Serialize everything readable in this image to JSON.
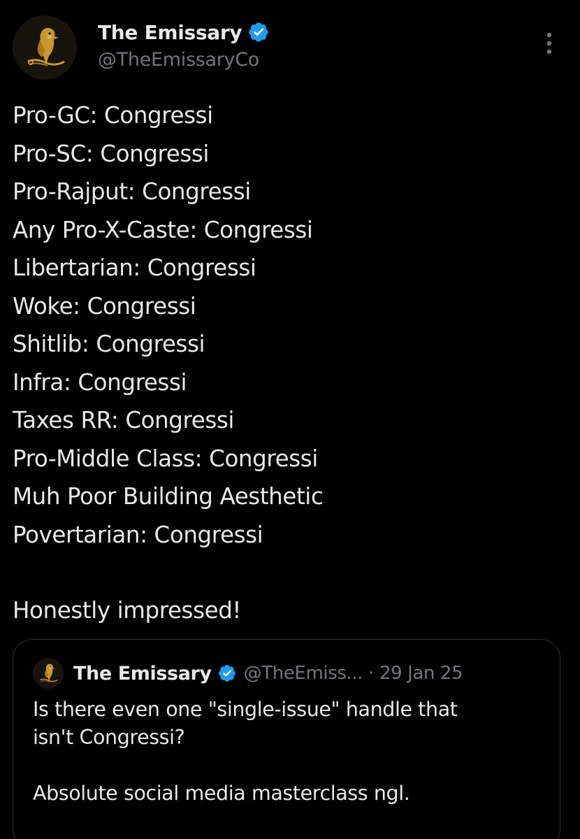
{
  "post": {
    "author": {
      "display_name": "The Emissary",
      "handle": "@TheEmissaryCo",
      "verified": true,
      "avatar_icon": "golden-bird-logo-icon"
    },
    "more_icon": "more-options-vertical-icon",
    "lines": [
      "Pro-GC: Congressi",
      "Pro-SC: Congressi",
      "Pro-Rajput: Congressi",
      "Any Pro-X-Caste: Congressi",
      "Libertarian: Congressi",
      "Woke: Congressi",
      "Shitlib: Congressi",
      "Infra: Congressi",
      "Taxes RR: Congressi",
      "Pro-Middle Class: Congressi",
      "Muh Poor Building Aesthetic",
      "Povertarian: Congressi"
    ],
    "closing": "Honestly impressed!"
  },
  "quoted": {
    "author": {
      "display_name": "The Emissary",
      "handle": "@TheEmiss...",
      "verified": true
    },
    "separator": "·",
    "date": "29 Jan 25",
    "lines": [
      "Is there even one \"single-issue\" handle that",
      "isn't Congressi?",
      "",
      "Absolute social media masterclass ngl."
    ]
  },
  "colors": {
    "background": "#000000",
    "text": "#e7e9ea",
    "secondary_text": "#71767b",
    "verified_badge": "#1d9bf0",
    "border": "#2f3336"
  }
}
